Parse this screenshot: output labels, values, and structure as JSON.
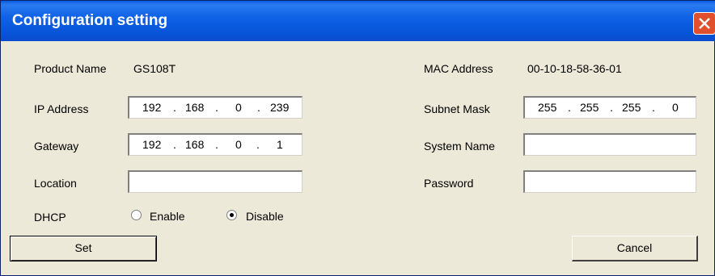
{
  "window": {
    "title": "Configuration setting"
  },
  "colors": {
    "titlebar": "#0a5ce0",
    "face": "#ece9d8",
    "close": "#e0502c"
  },
  "form": {
    "product_name_label": "Product Name",
    "product_name": "GS108T",
    "mac_label": "MAC Address",
    "mac": "00-10-18-58-36-01",
    "ip_label": "IP Address",
    "ip": [
      "192",
      "168",
      "0",
      "239"
    ],
    "subnet_label": "Subnet Mask",
    "subnet": [
      "255",
      "255",
      "255",
      "0"
    ],
    "gateway_label": "Gateway",
    "gateway": [
      "192",
      "168",
      "0",
      "1"
    ],
    "system_name_label": "System Name",
    "system_name": "",
    "location_label": "Location",
    "location": "",
    "password_label": "Password",
    "password": "",
    "dhcp_label": "DHCP",
    "dhcp_enable_label": "Enable",
    "dhcp_disable_label": "Disable",
    "dhcp_selected": "Disable",
    "dot": "."
  },
  "buttons": {
    "set": "Set",
    "cancel": "Cancel"
  },
  "icons": {
    "close": "close-icon"
  }
}
